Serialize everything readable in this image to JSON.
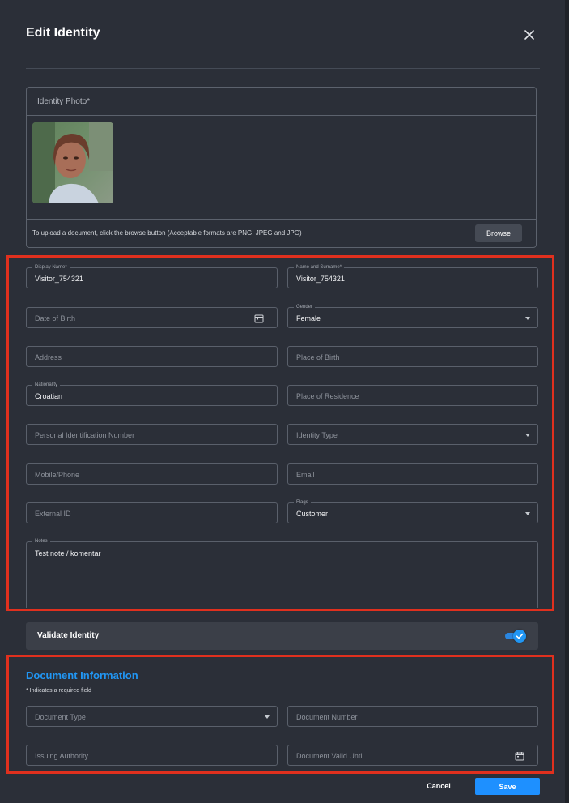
{
  "dialog": {
    "title": "Edit Identity"
  },
  "photo": {
    "label": "Identity Photo*",
    "hint": "To upload a document, click the browse button (Acceptable formats are PNG, JPEG and JPG)",
    "browse_label": "Browse"
  },
  "fields": {
    "display_name": {
      "label": "Display Name*",
      "value": "Visitor_754321"
    },
    "name_surname": {
      "label": "Name and Surname*",
      "value": "Visitor_754321"
    },
    "date_of_birth": {
      "placeholder": "Date of Birth"
    },
    "gender": {
      "label": "Gender",
      "value": "Female"
    },
    "address": {
      "placeholder": "Address"
    },
    "place_of_birth": {
      "placeholder": "Place of Birth"
    },
    "nationality": {
      "label": "Nationality",
      "value": "Croatian"
    },
    "place_of_residence": {
      "placeholder": "Place of Residence"
    },
    "personal_id": {
      "placeholder": "Personal Identification Number"
    },
    "identity_type": {
      "placeholder": "Identity Type"
    },
    "mobile": {
      "placeholder": "Mobile/Phone"
    },
    "email": {
      "placeholder": "Email"
    },
    "external_id": {
      "placeholder": "External ID"
    },
    "flags": {
      "label": "Flags",
      "value": "Customer"
    },
    "notes": {
      "label": "Notes",
      "value": "Test note / komentar"
    }
  },
  "validate": {
    "label": "Validate Identity",
    "enabled": true
  },
  "document": {
    "title": "Document Information",
    "required_note": "* Indicates a required field",
    "document_type": {
      "placeholder": "Document Type"
    },
    "document_number": {
      "placeholder": "Document Number"
    },
    "issuing_authority": {
      "placeholder": "Issuing Authority"
    },
    "valid_until": {
      "placeholder": "Document Valid Until"
    }
  },
  "actions": {
    "cancel_label": "Cancel",
    "save_label": "Save"
  },
  "colors": {
    "accent": "#2196f3",
    "highlight_border": "#e0301e",
    "background": "#2b2f38"
  },
  "icons": [
    "close-icon",
    "calendar-icon",
    "chevron-down-icon",
    "check-icon"
  ]
}
